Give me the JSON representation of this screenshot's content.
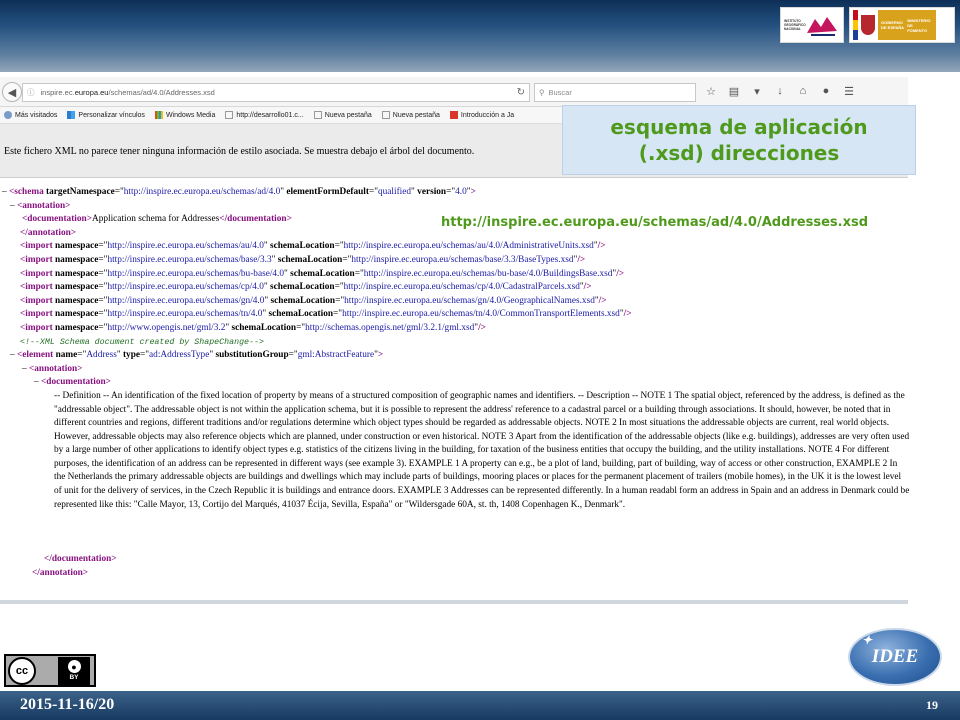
{
  "colors": {
    "header_dark": "#0d2f57",
    "callout_text": "#4f9a1c",
    "callout_bg": "#d6e6f4",
    "xml_tag": "#881280",
    "xml_value": "#1a1aa6",
    "xml_comment": "#236e25"
  },
  "logos": {
    "ign_text": "INSTITUTO GEOGRÁFICO NACIONAL",
    "gov_text_1": "GOBIERNO DE ESPAÑA",
    "gov_text_2": "MINISTERIO DE FOMENTO"
  },
  "browser": {
    "url_prefix": "inspire.ec.",
    "url_domain": "europa.eu",
    "url_suffix": "/schemas/ad/4.0/Addresses.xsd",
    "search_placeholder": "Buscar",
    "icons": [
      "back-icon",
      "info-icon",
      "reload-icon",
      "search-icon",
      "star-icon",
      "reading-list-icon",
      "pocket-icon",
      "download-icon",
      "home-icon",
      "chat-icon",
      "menu-icon"
    ],
    "bookmarks": [
      {
        "label": "Más visitados",
        "icon": "gear-icon"
      },
      {
        "label": "Personalizar vínculos",
        "icon": "windows-icon"
      },
      {
        "label": "Windows Media",
        "icon": "windows-icon"
      },
      {
        "label": "http://desarrollo01.c...",
        "icon": "page-icon"
      },
      {
        "label": "Nueva pestaña",
        "icon": "page-icon"
      },
      {
        "label": "Nueva pestaña",
        "icon": "page-icon"
      },
      {
        "label": "Introducción a Ja",
        "icon": "java-icon"
      }
    ],
    "xml_notice": "Este fichero XML no parece tener ninguna información de estilo asociada. Se muestra debajo el árbol del documento."
  },
  "callout": {
    "line1": "esquema de aplicación",
    "line2": "(.xsd) direcciones"
  },
  "url_caption": "http://inspire.ec.europa.eu/schemas/ad/4.0/Addresses.xsd",
  "xml": {
    "schema_open": "<schema",
    "schema_attrs": [
      {
        "name": "targetNamespace",
        "value": "http://inspire.ec.europa.eu/schemas/ad/4.0"
      },
      {
        "name": "elementFormDefault",
        "value": "qualified"
      },
      {
        "name": "version",
        "value": "4.0"
      }
    ],
    "annotation_open": "<annotation>",
    "documentation_open": "<documentation>",
    "documentation_close": "</documentation>",
    "schema_doc": "Application schema for Addresses",
    "annotation_close": "</annotation>",
    "imports": [
      {
        "namespace": "http://inspire.ec.europa.eu/schemas/au/4.0",
        "location": "http://inspire.ec.europa.eu/schemas/au/4.0/AdministrativeUnits.xsd"
      },
      {
        "namespace": "http://inspire.ec.europa.eu/schemas/base/3.3",
        "location": "http://inspire.ec.europa.eu/schemas/base/3.3/BaseTypes.xsd"
      },
      {
        "namespace": "http://inspire.ec.europa.eu/schemas/bu-base/4.0",
        "location": "http://inspire.ec.europa.eu/schemas/bu-base/4.0/BuildingsBase.xsd"
      },
      {
        "namespace": "http://inspire.ec.europa.eu/schemas/cp/4.0",
        "location": "http://inspire.ec.europa.eu/schemas/cp/4.0/CadastralParcels.xsd"
      },
      {
        "namespace": "http://inspire.ec.europa.eu/schemas/gn/4.0",
        "location": "http://inspire.ec.europa.eu/schemas/gn/4.0/GeographicalNames.xsd"
      },
      {
        "namespace": "http://inspire.ec.europa.eu/schemas/tn/4.0",
        "location": "http://inspire.ec.europa.eu/schemas/tn/4.0/CommonTransportElements.xsd"
      },
      {
        "namespace": "http://www.opengis.net/gml/3.2",
        "location": "http://schemas.opengis.net/gml/3.2.1/gml.xsd"
      }
    ],
    "comment": "<!--XML Schema document created by ShapeChange-->",
    "element_name": "Address",
    "element_type": "ad:AddressType",
    "element_subst": "gml:AbstractFeature",
    "address_doc": "-- Definition -- An identification of the fixed location of property by means of a structured composition of geographic names and identifiers. -- Description -- NOTE 1 The spatial object, referenced by the address, is defined as the \"addressable object\". The addressable object is not within the application schema, but it is possible to represent the address' reference to a cadastral parcel or a building through associations. It should, however, be noted that in different countries and regions, different traditions and/or regulations determine which object types should be regarded as addressable objects. NOTE 2 In most situations the addressable objects are current, real world objects. However, addressable objects may also reference objects which are planned, under construction or even historical. NOTE 3 Apart from the identification of the addressable objects (like e.g. buildings), addresses are very often used by a large number of other applications to identify object types e.g. statistics of the citizens living in the building, for taxation of the business entities that occupy the building, and the utility installations. NOTE 4 For different purposes, the identification of an address can be represented in different ways (see example 3). EXAMPLE 1 A property can e.g., be a plot of land, building, part of building, way of access or other construction, EXAMPLE 2 In the Netherlands the primary addressable objects are buildings and dwellings which may include parts of buildings, mooring places or places for the permanent placement of trailers (mobile homes), in the UK it is the lowest level of unit for the delivery of services, in the Czech Republic it is buildings and entrance doors. EXAMPLE 3 Addresses can be represented differently. In a human readabl form an address in Spain and an address in Denmark could be represented like this: \"Calle Mayor, 13, Cortijo del Marqués, 41037 Écija, Sevilla, España\" or \"Wildersgade 60A, st. th, 1408 Copenhagen K., Denmark\"."
  },
  "footer": {
    "date": "2015-11-16/20",
    "page": "19",
    "license_label": "BY",
    "logo_text": "IDEE"
  }
}
